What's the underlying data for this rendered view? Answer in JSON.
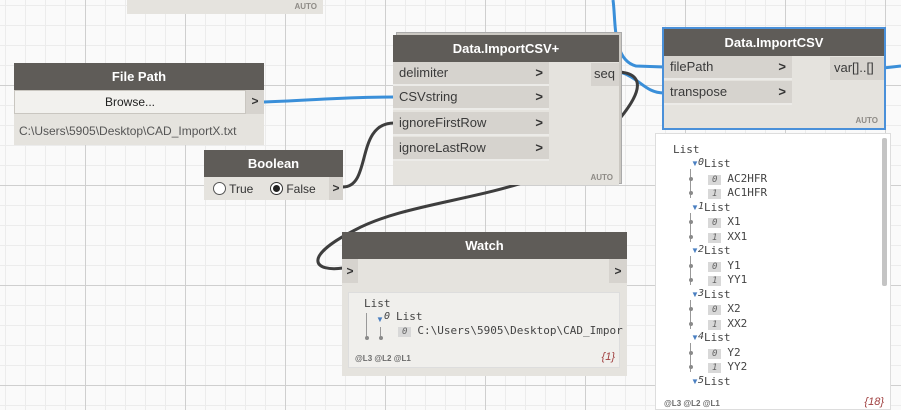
{
  "nodes": {
    "top_partial": {
      "auto": "AUTO"
    },
    "file_path": {
      "title": "File Path",
      "browse_label": "Browse...",
      "output_chevron": ">",
      "path_value": "C:\\Users\\5905\\Desktop\\CAD_ImportX.txt"
    },
    "boolean": {
      "title": "Boolean",
      "true_label": "True",
      "false_label": "False",
      "selected": "False",
      "output_chevron": ">"
    },
    "import_csv_plus": {
      "title": "Data.ImportCSV+",
      "inputs": [
        "delimiter",
        "CSVstring",
        "ignoreFirstRow",
        "ignoreLastRow"
      ],
      "output": "seq",
      "auto": "AUTO",
      "chevron": ">"
    },
    "import_csv": {
      "title": "Data.ImportCSV",
      "inputs": [
        "filePath",
        "transpose"
      ],
      "output": "var[]..[]",
      "auto": "AUTO",
      "chevron": ">"
    },
    "watch": {
      "title": "Watch",
      "in_chevron": ">",
      "out_chevron": ">",
      "list_root": "List",
      "sub_index": "0",
      "sub_label": "List",
      "item_index": "0",
      "item_value": "C:\\Users\\5905\\Desktop\\CAD_Impor",
      "levels": "@L3 @L2 @L1",
      "count": "{1}"
    }
  },
  "preview": {
    "root": "List",
    "groups": [
      {
        "index": "0",
        "label": "List",
        "items": [
          {
            "i": "0",
            "v": "AC2HFR"
          },
          {
            "i": "1",
            "v": "AC1HFR"
          }
        ]
      },
      {
        "index": "1",
        "label": "List",
        "items": [
          {
            "i": "0",
            "v": "X1"
          },
          {
            "i": "1",
            "v": "XX1"
          }
        ]
      },
      {
        "index": "2",
        "label": "List",
        "items": [
          {
            "i": "0",
            "v": "Y1"
          },
          {
            "i": "1",
            "v": "YY1"
          }
        ]
      },
      {
        "index": "3",
        "label": "List",
        "items": [
          {
            "i": "0",
            "v": "X2"
          },
          {
            "i": "1",
            "v": "XX2"
          }
        ]
      },
      {
        "index": "4",
        "label": "List",
        "items": [
          {
            "i": "0",
            "v": "Y2"
          },
          {
            "i": "1",
            "v": "YY2"
          }
        ]
      },
      {
        "index": "5",
        "label": "List",
        "items": []
      }
    ],
    "levels": "@L3 @L2 @L1",
    "count": "{18}"
  },
  "colors": {
    "wire_selected": "#3a8fd9",
    "wire": "#3e3e3e",
    "node_header": "#5f5c58",
    "node_body": "#e5e3de",
    "selection": "#4a90d9"
  }
}
